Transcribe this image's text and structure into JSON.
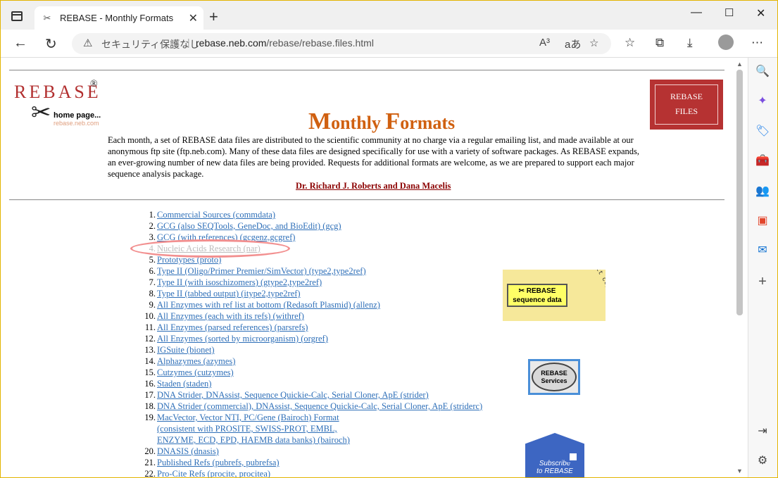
{
  "browser": {
    "tab_title": "REBASE - Monthly Formats",
    "tab_close": "✕",
    "new_tab": "+",
    "security_label": "セキュリティ保護なし",
    "separator": "|",
    "url_host": "rebase.neb.com",
    "url_path": "/rebase/rebase.files.html",
    "read_aloud": "A³",
    "translate": "aあ"
  },
  "logo": {
    "name": "REBASE",
    "reg": "®",
    "home": "home page...",
    "url": "rebase.neb.com"
  },
  "page": {
    "title_big_m": "M",
    "title_rest_1": "onthly ",
    "title_big_f": "F",
    "title_rest_2": "ormats",
    "intro": "Each month, a set of REBASE data files are distributed to the scientific community at no charge via a regular emailing list, and made available at our anonymous ftp site (ftp.neb.com). Many of these data files are designed specifically for use with a variety of software packages. As REBASE expands, an ever-growing number of new data files are being provided. Requests for additional formats are welcome, as we are prepared to support each major sequence analysis package.",
    "authors": "Dr. Richard J. Roberts and Dana Macelis",
    "rebase_files_1": "REBASE",
    "rebase_files_2": "FILES"
  },
  "list": [
    {
      "n": "1.",
      "text": "Commercial Sources   (commdata)"
    },
    {
      "n": "2.",
      "text": "GCG (also SEQTools, GeneDoc, and BioEdit)   (gcg)"
    },
    {
      "n": "3.",
      "text": "GCG (with references)   (gcgenz,gcgref)"
    },
    {
      "n": "4.",
      "text": "Nucleic Acids Research   (nar)"
    },
    {
      "n": "5.",
      "text": "Prototypes   (proto)"
    },
    {
      "n": "6.",
      "text": "Type II (Oligo/Primer Premier/SimVector)   (type2,type2ref)"
    },
    {
      "n": "7.",
      "text": "Type II (with isoschizomers)   (gtype2,type2ref)"
    },
    {
      "n": "8.",
      "text": "Type II (tabbed output)   (itype2,type2ref)"
    },
    {
      "n": "9.",
      "text": "All Enzymes with ref list at bottom (Redasoft Plasmid)   (allenz)"
    },
    {
      "n": "10.",
      "text": "All Enzymes (each with its refs)   (withref)"
    },
    {
      "n": "11.",
      "text": "All Enzymes (parsed references)   (parsrefs)"
    },
    {
      "n": "12.",
      "text": "All Enzymes (sorted by microorganism)   (orgref)"
    },
    {
      "n": "13.",
      "text": "IGSuite   (bionet)"
    },
    {
      "n": "14.",
      "text": "Alphazymes   (azymes)"
    },
    {
      "n": "15.",
      "text": "Cutzymes   (cutzymes)"
    },
    {
      "n": "16.",
      "text": "Staden   (staden)"
    },
    {
      "n": "17.",
      "text": "DNA Strider, DNAssist, Sequence Quickie-Calc, Serial Cloner, ApE   (strider)"
    },
    {
      "n": "18.",
      "text": "DNA Strider (commercial), DNAssist, Sequence Quickie-Calc, Serial Cloner, ApE   (striderc)"
    },
    {
      "n": "19.",
      "text_1": "MacVector, Vector NTI, PC/Gene (Bairoch) Format",
      "text_2": "(consistent with PROSITE, SWISS-PROT, EMBL,",
      "text_3": "ENZYME, ECD, EPD, HAEMB data banks)   (bairoch)"
    },
    {
      "n": "20.",
      "text": "DNASIS   (dnasis)"
    },
    {
      "n": "21.",
      "text": "Published Refs   (pubrefs, pubrefsa)"
    },
    {
      "n": "22.",
      "text": "Pro-Cite Refs   (procite, procitea)"
    }
  ],
  "badges": {
    "seq_1": "REBASE",
    "seq_2": "sequence data",
    "seq_bg": "gaattc ggatcc aagctt ctgcag gtcgac",
    "services_1": "REBASE",
    "services_2": "Services",
    "subscribe_1": "Subscribe",
    "subscribe_2": "to REBASE"
  }
}
